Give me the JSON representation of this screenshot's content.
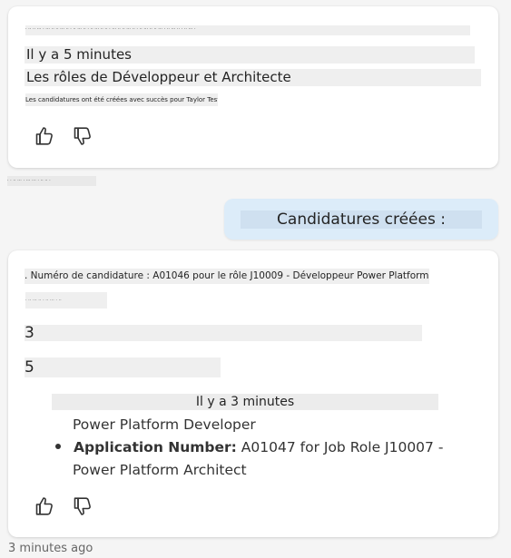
{
  "top_timestamp": "· · ·· ··· · ··· ··· · ·· ·· ·",
  "first_message": {
    "tiny_line": "· ·· ·· ··· · ··· ·· ·· ··· ·· · ·· ··· ·· · ·· ··· ·· ·· · ··· ·· ·· ··· ·· · ·· ··· ·· ·· ··· · ·· ··· ·· · ·· ··· ·",
    "time_label": "Il y a 5 minutes",
    "title": "Les rôles de Développeur et Architecte",
    "description": "Les candidatures ont été créées avec succès pour Taylor Testperson."
  },
  "user_bubble": {
    "text": "Candidatures créées :"
  },
  "second_message": {
    "heading": ". Numéro de candidature : A01046 pour le rôle J10009 - Développeur Power Platform",
    "tiny_line": "· ·· ··· ·· · ·· ··· · ··",
    "number_a": "3",
    "number_b": "5",
    "time_label": "Il y a 3 minutes",
    "line_dev": "Power Platform Developer",
    "bullet_label": "Application Number:",
    "bullet_value": " A01047 for Job Role J10007 -",
    "line_arch": "Power Platform Architect"
  },
  "bottom_timestamp": "3 minutes ago",
  "icons": {
    "like": "thumbs-up-icon",
    "dislike": "thumbs-down-icon"
  },
  "colors": {
    "bubble_bg": "#dcecf9",
    "card_bg": "#ffffff",
    "page_bg": "#f5f5f5"
  }
}
